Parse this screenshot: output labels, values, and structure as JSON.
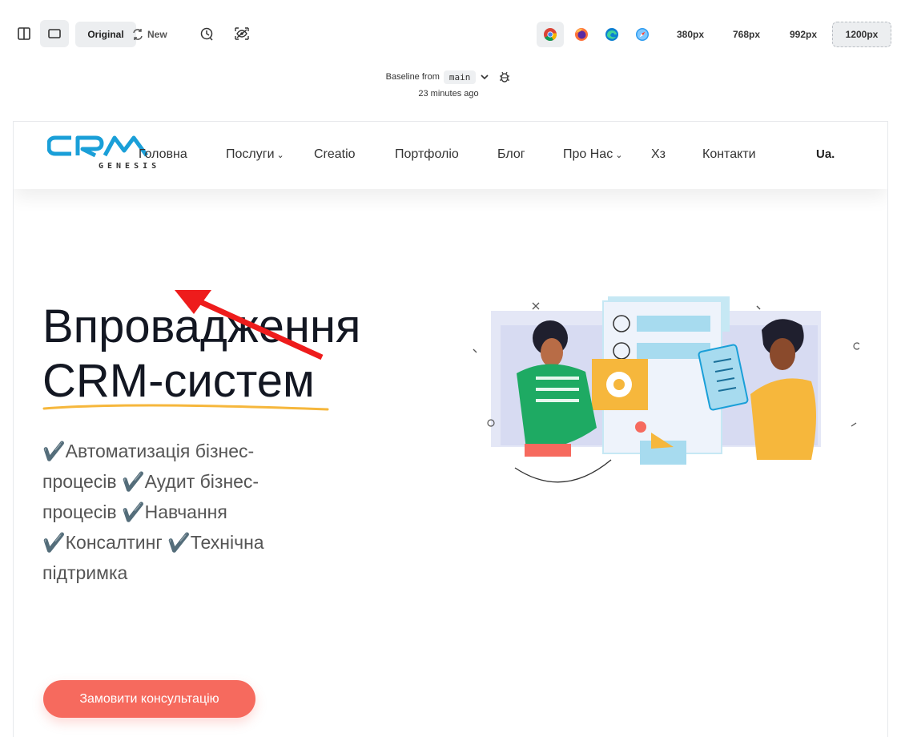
{
  "toolbar": {
    "original_label": "Original",
    "new_label": "New",
    "breakpoints": [
      "380px",
      "768px",
      "992px",
      "1200px"
    ],
    "active_breakpoint": "1200px",
    "browsers": [
      "chrome-icon",
      "firefox-icon",
      "edge-icon",
      "safari-icon"
    ]
  },
  "baseline": {
    "prefix": "Baseline from",
    "branch": "main",
    "time": "23 minutes ago"
  },
  "site": {
    "logo": {
      "text": "CRM",
      "sub": "GENESIS"
    },
    "nav": [
      {
        "label": "Головна"
      },
      {
        "label": "Послуги",
        "dropdown": true
      },
      {
        "label": "Creatio"
      },
      {
        "label": "Портфоліо"
      },
      {
        "label": "Блог"
      },
      {
        "label": "Про Нас",
        "dropdown": true
      },
      {
        "label": "Хз"
      },
      {
        "label": "Контакти"
      }
    ],
    "nav_chevron": "⌄",
    "lang": "Ua.",
    "hero": {
      "title": "Впровадження CRM-систем",
      "text": "✔️Автоматизація бізнес-процесів ✔️Аудит бізнес-процесів ✔️Навчання ✔️Консалтинг ✔️Технічна підтримка",
      "cta": "Замовити консультацію"
    }
  },
  "colors": {
    "accent": "#f66a5e",
    "logo_blue": "#1a9fd8",
    "underline": "#f6b73c",
    "annotation": "#ee1c1c"
  }
}
